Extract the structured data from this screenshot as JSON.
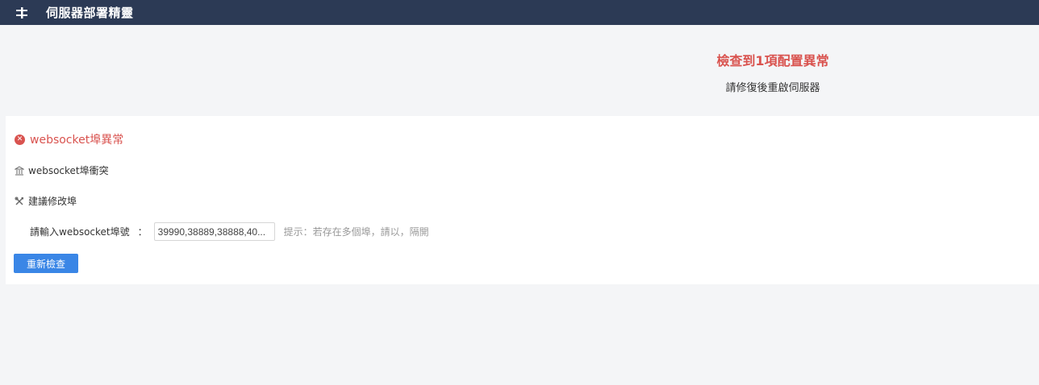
{
  "app": {
    "title": "伺服器部署精靈"
  },
  "summary": {
    "title": "檢查到1項配置異常",
    "subtitle": "請修復後重啟伺服器",
    "accent_color": "#d9534f"
  },
  "issue": {
    "title": "websocket埠異常",
    "problem_icon": "building-icon",
    "problem_text": "websocket埠衝突",
    "suggest_icon": "tools-icon",
    "suggest_text": "建議修改埠",
    "input_label": "請輸入websocket埠號",
    "input_colon": "：",
    "input_value": "39990,38889,38888,40...",
    "hint": "提示：若存在多個埠，請以，隔開"
  },
  "actions": {
    "recheck_label": "重新檢查",
    "button_color": "#3a86e6"
  },
  "colors": {
    "topbar": "#2c3a55",
    "background": "#f4f5f7"
  }
}
